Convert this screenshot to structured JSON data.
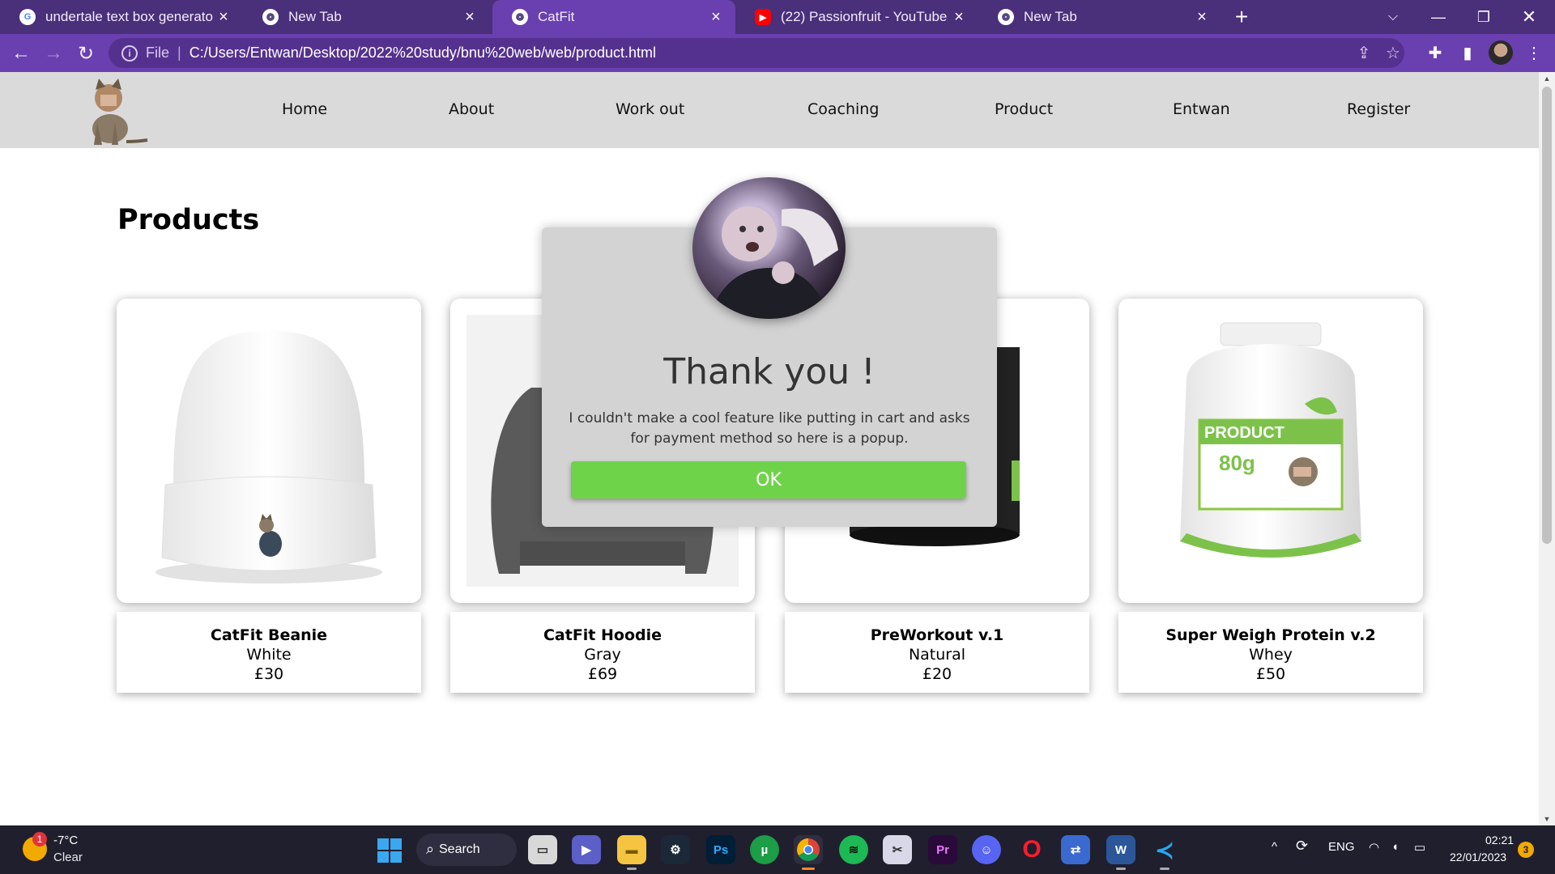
{
  "browser": {
    "tabs": [
      {
        "title": "undertale text box generator - Go",
        "favicon": "google-icon",
        "active": false
      },
      {
        "title": "New Tab",
        "favicon": "chrome-icon",
        "active": false
      },
      {
        "title": "CatFit",
        "favicon": "chrome-icon",
        "active": true
      },
      {
        "title": "(22) Passionfruit - YouTube",
        "favicon": "youtube-icon",
        "active": false
      },
      {
        "title": "New Tab",
        "favicon": "chrome-icon",
        "active": false
      }
    ],
    "address": {
      "scheme_label": "File",
      "url": "C:/Users/Entwan/Desktop/2022%20study/bnu%20web/web/product.html"
    },
    "colors": {
      "frame": "#4a2f7a",
      "toolbar": "#6a3fb0",
      "omnibox": "#55318f"
    }
  },
  "site": {
    "nav": [
      "Home",
      "About",
      "Work out",
      "Coaching",
      "Product",
      "Entwan",
      "Register"
    ],
    "section_title": "Products",
    "products": [
      {
        "name": "CatFit Beanie",
        "variant": "White",
        "price": "£30"
      },
      {
        "name": "CatFit Hoodie",
        "variant": "Gray",
        "price": "£69"
      },
      {
        "name": "PreWorkout v.1",
        "variant": "Natural",
        "price": "£20"
      },
      {
        "name": "Super Weigh Protein v.2",
        "variant": "Whey",
        "price": "£50"
      }
    ],
    "protein_label": {
      "brand": "PRODUCT",
      "weight": "80g"
    }
  },
  "modal": {
    "title": "Thank you !",
    "message": "I couldn't make a cool feature like putting in cart and asks for payment method so here is a popup.",
    "ok_label": "OK",
    "ok_color": "#6fd34a"
  },
  "taskbar": {
    "weather": {
      "temp": "-7°C",
      "condition": "Clear",
      "badge": "1"
    },
    "search_label": "Search",
    "language": "ENG",
    "time": "02:21",
    "date": "22/01/2023",
    "notifications": "3"
  }
}
